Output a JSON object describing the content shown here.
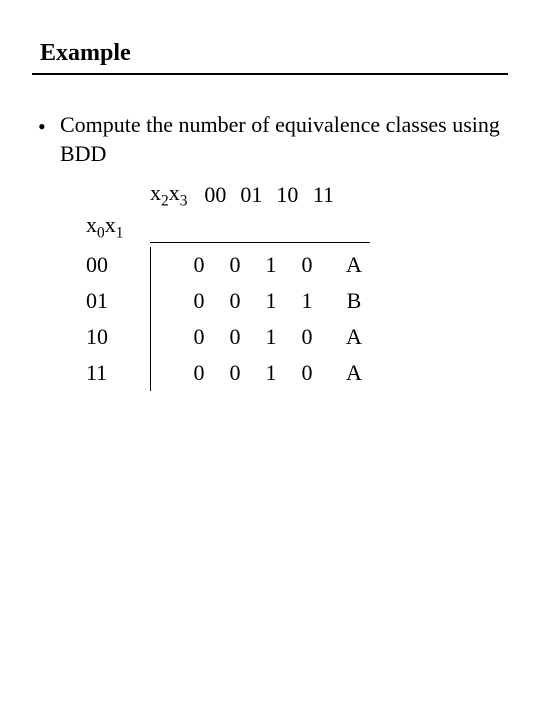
{
  "title": "Example",
  "bullet": "Compute the number of equivalence classes using BDD",
  "col_var": {
    "base": "x",
    "sub1": "2",
    "sub2": "3"
  },
  "row_var": {
    "base": "x",
    "sub1": "0",
    "sub2": "1"
  },
  "col_headers": [
    "00",
    "01",
    "10",
    "11"
  ],
  "rows": [
    {
      "label": "00",
      "cells": [
        "0",
        "0",
        "1",
        "0"
      ],
      "cls": "A"
    },
    {
      "label": "01",
      "cells": [
        "0",
        "0",
        "1",
        "1"
      ],
      "cls": "B"
    },
    {
      "label": "10",
      "cells": [
        "0",
        "0",
        "1",
        "0"
      ],
      "cls": "A"
    },
    {
      "label": "11",
      "cells": [
        "0",
        "0",
        "1",
        "0"
      ],
      "cls": "A"
    }
  ],
  "chart_data": {
    "type": "table",
    "row_variable": "x0x1",
    "col_variable": "x2x3",
    "col_headers": [
      "00",
      "01",
      "10",
      "11"
    ],
    "row_headers": [
      "00",
      "01",
      "10",
      "11"
    ],
    "values": [
      [
        0,
        0,
        1,
        0
      ],
      [
        0,
        0,
        1,
        1
      ],
      [
        0,
        0,
        1,
        0
      ],
      [
        0,
        0,
        1,
        0
      ]
    ],
    "equivalence_classes": [
      "A",
      "B",
      "A",
      "A"
    ],
    "title": "Compute the number of equivalence classes using BDD"
  }
}
